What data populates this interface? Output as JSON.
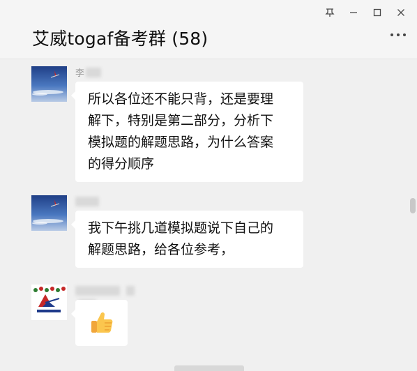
{
  "window": {
    "title": "艾威togaf备考群 (58)",
    "controls": [
      "pin",
      "minimize",
      "maximize",
      "close"
    ]
  },
  "messages": [
    {
      "sender": "李",
      "sender_blurred": true,
      "avatar": "sky-airplane-photo",
      "lines": [
        "所以各位还不能只背，还是要理",
        "解下，特别是第二部分，分析下",
        "模拟题的解题思路，为什么答案",
        "的得分顺序"
      ]
    },
    {
      "sender": "",
      "sender_blurred": true,
      "avatar": "sky-airplane-photo",
      "lines": [
        "我下午挑几道模拟题说下自己的",
        "解题思路，给各位参考，"
      ]
    },
    {
      "sender": "",
      "sender_blurred": true,
      "avatar": "avtech-logo",
      "content_type": "emoji",
      "emoji": "👍",
      "emoji_name": "thumbs-up"
    }
  ],
  "colors": {
    "background": "#f0f0f0",
    "bubble": "#ffffff",
    "title_text": "#111111"
  }
}
